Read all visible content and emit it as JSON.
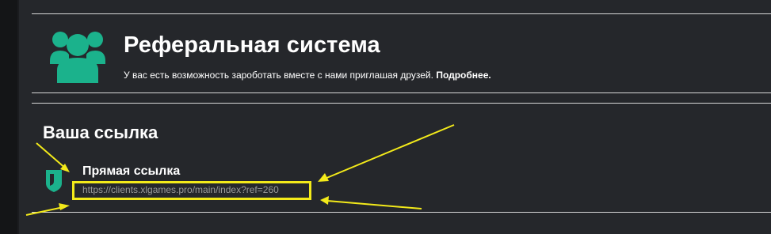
{
  "header": {
    "title": "Реферальная система",
    "description": "У вас есть возможность зароботать вместе с нами приглашая друзей. ",
    "more_link": "Подробнее."
  },
  "link_section": {
    "title": "Ваша ссылка",
    "direct_link": {
      "label": "Прямая ссылка",
      "url": "https://clients.xlgames.pro/main/index?ref=260"
    }
  },
  "colors": {
    "accent": "#1bb28c",
    "annotation": "#f3ea1a",
    "background": "#25272b"
  },
  "icons": {
    "hero": "users-group-icon",
    "direct_link": "shield-link-icon"
  }
}
